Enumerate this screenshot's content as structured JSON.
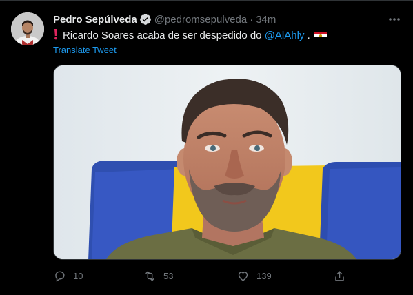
{
  "tweet": {
    "author_name": "Pedro Sepúlveda",
    "handle": "@pedromsepulveda",
    "separator": "·",
    "time": "34m",
    "text_before_mention": "Ricardo Soares acaba de ser despedido do ",
    "mention": "@AlAhly",
    "text_after_mention": " .",
    "translate_label": "Translate Tweet"
  },
  "actions": {
    "reply_count": "10",
    "retweet_count": "53",
    "like_count": "139"
  },
  "icons": {
    "verified": "verified-badge-icon",
    "more": "more-options-icon",
    "exclamation": "red-exclamation-icon",
    "flag": "egypt-flag-icon",
    "reply": "reply-icon",
    "retweet": "retweet-icon",
    "like": "heart-icon",
    "share": "share-icon"
  },
  "colors": {
    "background": "#000000",
    "text": "#e7e9ea",
    "muted": "#71767b",
    "link": "#1d9bf0",
    "exclamation": "#e0245e"
  }
}
